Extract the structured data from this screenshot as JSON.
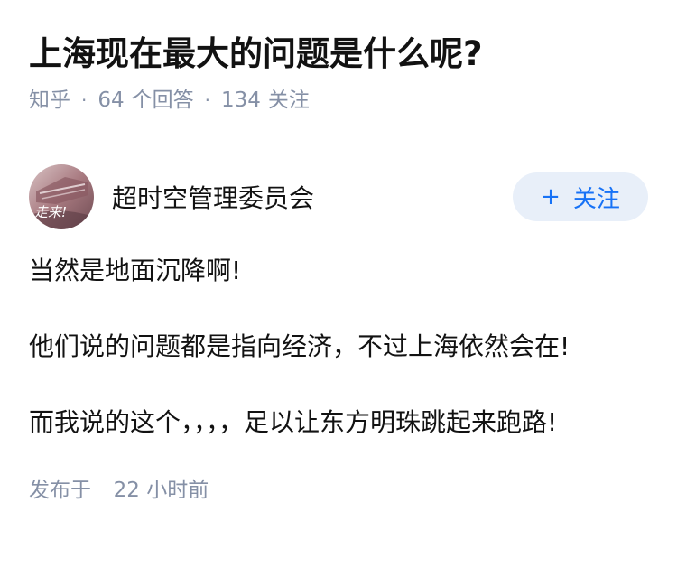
{
  "question": {
    "title": "上海现在最大的问题是什么呢?",
    "source": "知乎",
    "answer_count": "64",
    "answer_label": "个回答",
    "follower_count": "134",
    "follower_label": "关注"
  },
  "answer": {
    "author_name": "超时空管理委员会",
    "avatar_text": "走来!",
    "follow_button": {
      "icon": "plus-icon",
      "label": "关注"
    },
    "paragraphs": [
      "当然是地面沉降啊!",
      "他们说的问题都是指向经济，不过上海依然会在!",
      "而我说的这个，，，，足以让东方明珠跳起来跑路!"
    ],
    "footer": {
      "prefix": "发布于",
      "time": "22 小时前"
    }
  },
  "colors": {
    "title": "#121212",
    "meta": "#8590a6",
    "accent": "#1772f6",
    "follow_bg": "#e8eff9",
    "divider": "#ebebeb"
  }
}
